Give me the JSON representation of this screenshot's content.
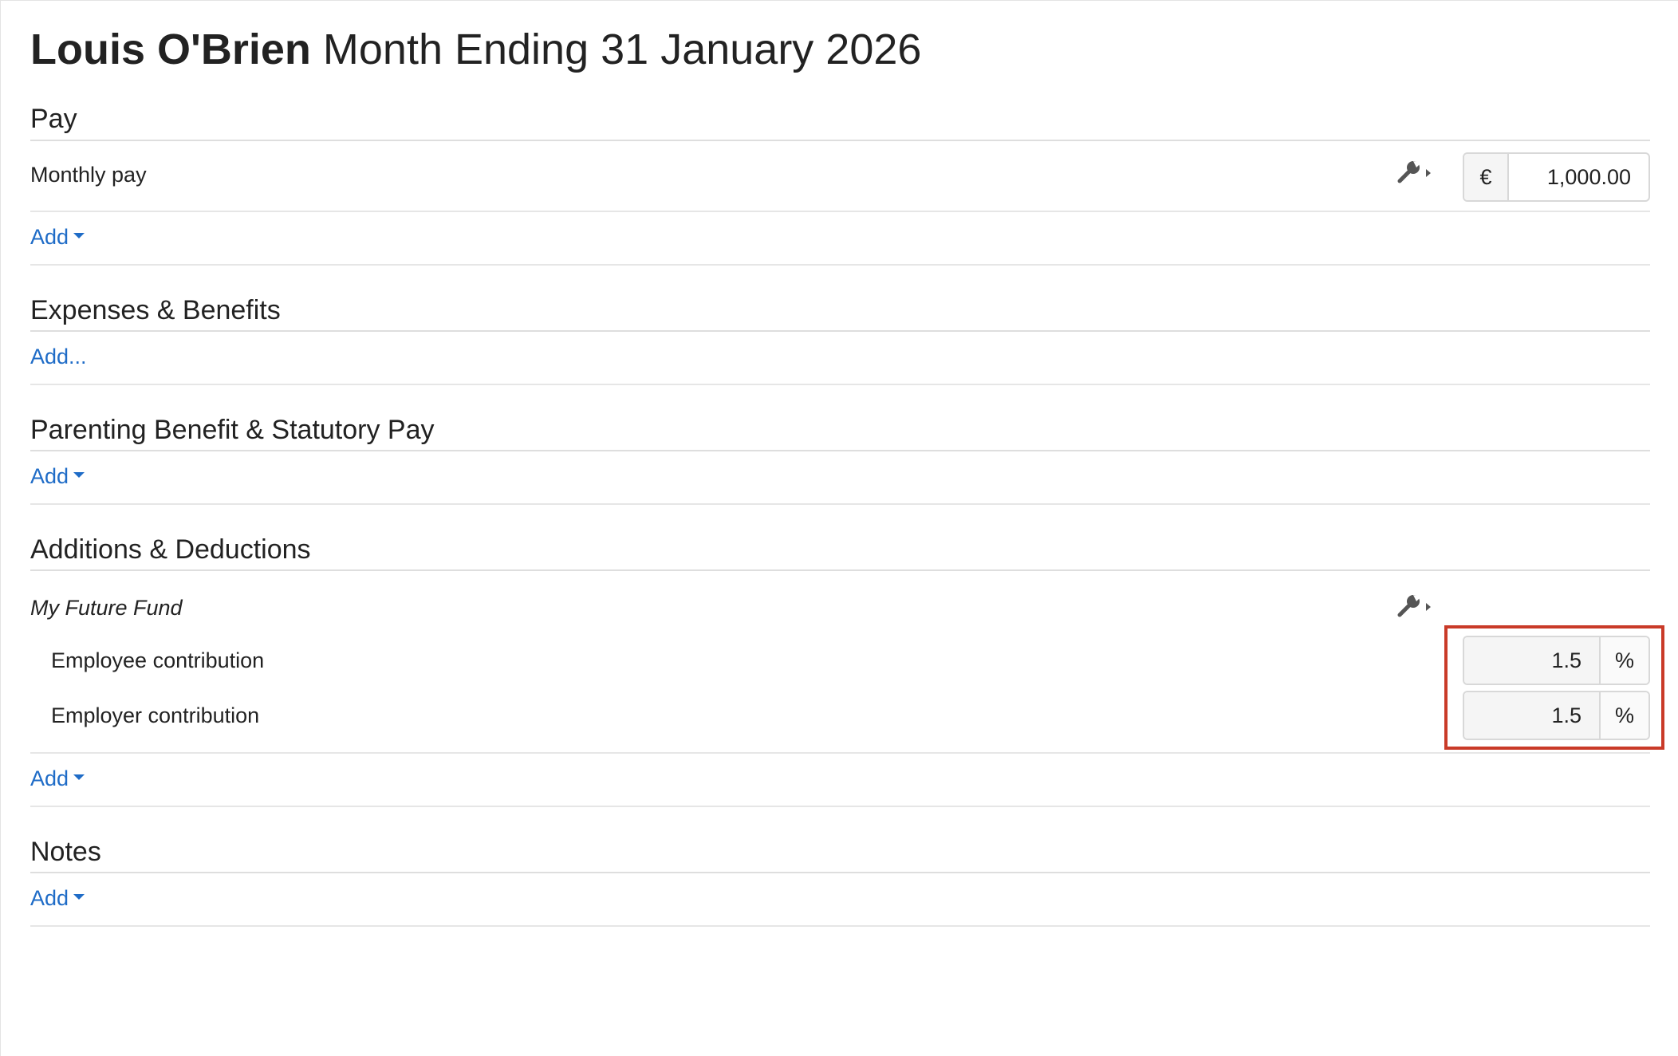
{
  "header": {
    "employee_name": "Louis O'Brien",
    "period": "Month Ending 31 January 2026"
  },
  "pay": {
    "heading": "Pay",
    "item_label": "Monthly pay",
    "currency_symbol": "€",
    "amount": "1,000.00",
    "add_label": "Add"
  },
  "expenses": {
    "heading": "Expenses & Benefits",
    "add_label": "Add..."
  },
  "parenting": {
    "heading": "Parenting Benefit & Statutory Pay",
    "add_label": "Add"
  },
  "additions": {
    "heading": "Additions & Deductions",
    "fund_label": "My Future Fund",
    "employee_label": "Employee contribution",
    "employee_value": "1.5",
    "employer_label": "Employer contribution",
    "employer_value": "1.5",
    "percent_symbol": "%",
    "add_label": "Add"
  },
  "notes": {
    "heading": "Notes",
    "add_label": "Add"
  },
  "icons": {
    "settings": "wrench-icon",
    "dropdown": "caret-down-icon"
  },
  "colors": {
    "link": "#1f6cc7",
    "highlight": "#c93a28"
  }
}
